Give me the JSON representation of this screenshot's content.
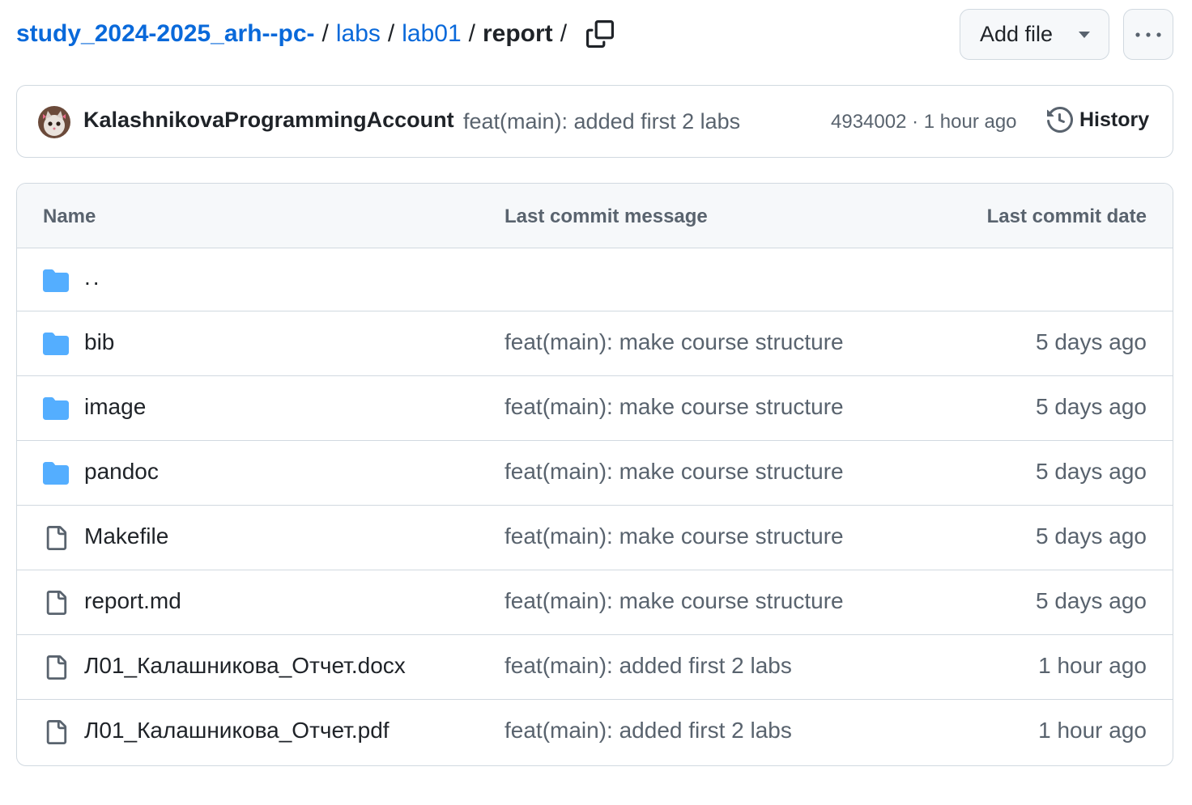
{
  "breadcrumb": {
    "repo": "study_2024-2025_arh--pc-",
    "segments": [
      "labs",
      "lab01"
    ],
    "current": "report",
    "separator": "/"
  },
  "toolbar": {
    "add_file_label": "Add file",
    "more_icon": "kebab-horizontal-icon",
    "copy_icon": "copy-icon"
  },
  "commit": {
    "author": "KalashnikovaProgrammingAccount",
    "message": "feat(main): added first 2 labs",
    "meta": "4934002 · 1 hour ago",
    "history_label": "History"
  },
  "table": {
    "headers": {
      "name": "Name",
      "message": "Last commit message",
      "date": "Last commit date"
    },
    "parent_label": "..",
    "rows": [
      {
        "type": "folder",
        "name": "bib",
        "message": "feat(main): make course structure",
        "date": "5 days ago"
      },
      {
        "type": "folder",
        "name": "image",
        "message": "feat(main): make course structure",
        "date": "5 days ago"
      },
      {
        "type": "folder",
        "name": "pandoc",
        "message": "feat(main): make course structure",
        "date": "5 days ago"
      },
      {
        "type": "file",
        "name": "Makefile",
        "message": "feat(main): make course structure",
        "date": "5 days ago"
      },
      {
        "type": "file",
        "name": "report.md",
        "message": "feat(main): make course structure",
        "date": "5 days ago"
      },
      {
        "type": "file",
        "name": "Л01_Калашникова_Отчет.docx",
        "message": "feat(main): added first 2 labs",
        "date": "1 hour ago"
      },
      {
        "type": "file",
        "name": "Л01_Калашникова_Отчет.pdf",
        "message": "feat(main): added first 2 labs",
        "date": "1 hour ago"
      }
    ]
  },
  "colors": {
    "link": "#0969da",
    "folder": "#54aeff",
    "border": "#d1d9e0",
    "muted": "#59636e",
    "header_bg": "#f6f8fa"
  }
}
